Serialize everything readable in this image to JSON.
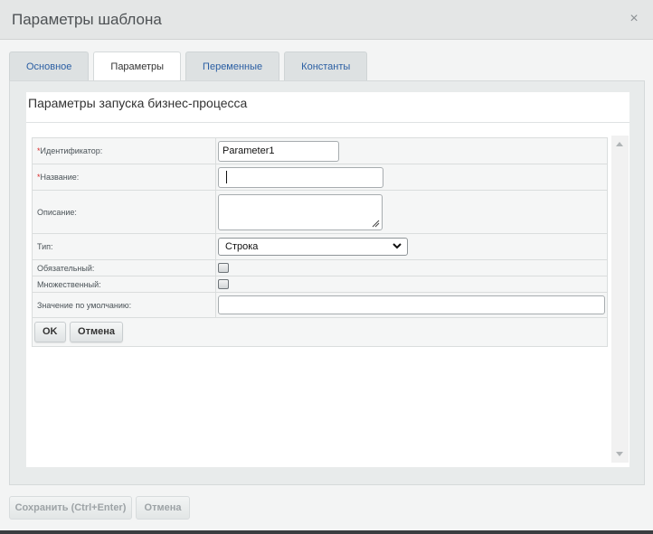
{
  "dialog": {
    "title": "Параметры шаблона",
    "close_glyph": "×"
  },
  "tabs": [
    {
      "label": "Основное",
      "active": false
    },
    {
      "label": "Параметры",
      "active": true
    },
    {
      "label": "Переменные",
      "active": false
    },
    {
      "label": "Константы",
      "active": false
    }
  ],
  "section": {
    "title": "Параметры запуска бизнес-процесса"
  },
  "form": {
    "required_mark": "*",
    "identifier": {
      "label": "Идентификатор:",
      "value": "Parameter1"
    },
    "name": {
      "label": "Название:",
      "value": ""
    },
    "description": {
      "label": "Описание:",
      "value": ""
    },
    "type": {
      "label": "Тип:",
      "selected": "Строка"
    },
    "required": {
      "label": "Обязательный:",
      "checked": false
    },
    "multiple": {
      "label": "Множественный:",
      "checked": false
    },
    "default": {
      "label": "Значение по умолчанию:",
      "value": ""
    },
    "ok_label": "OK",
    "cancel_label": "Отмена"
  },
  "footer": {
    "save_label": "Сохранить (Ctrl+Enter)",
    "cancel_label": "Отмена"
  },
  "icons": {
    "close": "close-icon",
    "dropdown": "chevron-down-icon",
    "scroll_up": "scroll-up-arrow-icon",
    "scroll_down": "scroll-down-arrow-icon"
  },
  "colors": {
    "required": "#d72828",
    "tab_link": "#2a5ea3"
  }
}
